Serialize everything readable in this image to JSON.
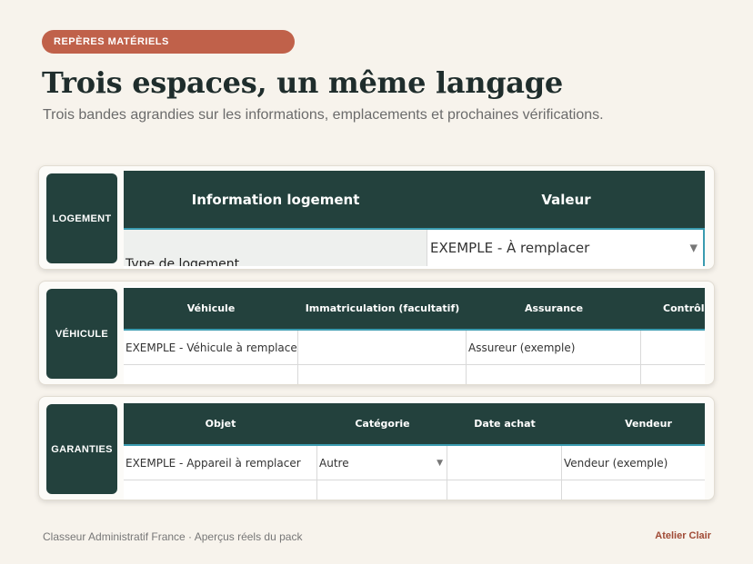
{
  "badge": "REPÈRES MATÉRIELS",
  "title": "Trois espaces, un même langage",
  "subtitle": "Trois bandes agrandies sur les informations, emplacements et prochaines vérifications.",
  "cards": [
    {
      "tag": "LOGEMENT",
      "headers": [
        "Information logement",
        "Valeur"
      ],
      "row": [
        "Type de logement",
        "EXEMPLE - À remplacer"
      ]
    },
    {
      "tag": "VÉHICULE",
      "headers": [
        "Véhicule",
        "Immatriculation (facultatif)",
        "Assurance",
        "Contrôle /"
      ],
      "row": [
        "EXEMPLE - Véhicule à remplacer",
        "",
        "Assureur (exemple)",
        ""
      ]
    },
    {
      "tag": "GARANTIES",
      "headers": [
        "Objet",
        "Catégorie",
        "Date achat",
        "Vendeur"
      ],
      "row": [
        "EXEMPLE - Appareil à remplacer",
        "Autre",
        "",
        "Vendeur (exemple)"
      ]
    }
  ],
  "icons": {
    "dropdown": "▼"
  },
  "colors": {
    "accent": "#c0614a",
    "header": "#23413d",
    "header_border": "#3a9bb0",
    "brand": "#a04a35"
  },
  "footer": {
    "left": "Classeur Administratif France · Aperçus réels du pack",
    "right": "Atelier Clair"
  }
}
